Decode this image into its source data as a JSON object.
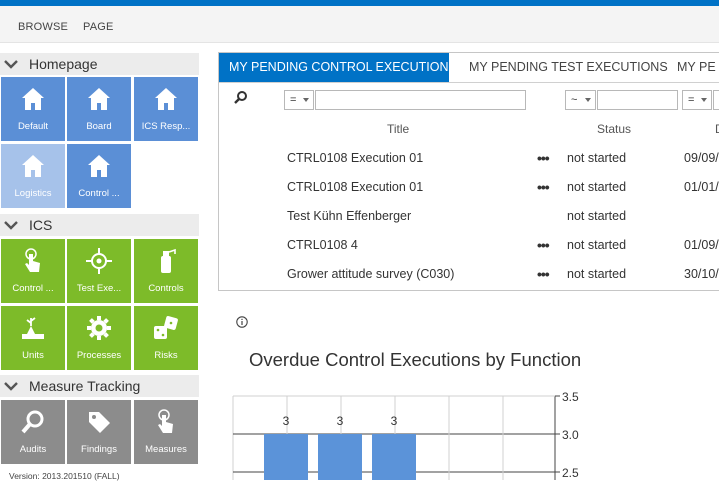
{
  "ribbon": {
    "tabs": [
      "BROWSE",
      "PAGE"
    ]
  },
  "nav": {
    "sections": [
      {
        "label": "Homepage",
        "tiles": [
          {
            "label": "Default",
            "icon": "home-icon"
          },
          {
            "label": "Board",
            "icon": "home-icon"
          },
          {
            "label": "ICS Resp...",
            "icon": "home-icon"
          },
          {
            "label": "Logistics",
            "icon": "home-icon"
          },
          {
            "label": "Control ...",
            "icon": "home-icon"
          }
        ]
      },
      {
        "label": "ICS",
        "tiles": [
          {
            "label": "Control ...",
            "icon": "touch-hand-icon"
          },
          {
            "label": "Test Exe...",
            "icon": "target-icon"
          },
          {
            "label": "Controls",
            "icon": "fire-extinguisher-icon"
          },
          {
            "label": "Units",
            "icon": "growth-plant-icon"
          },
          {
            "label": "Processes",
            "icon": "gear-icon"
          },
          {
            "label": "Risks",
            "icon": "dice-icon"
          }
        ]
      },
      {
        "label": "Measure Tracking",
        "tiles": [
          {
            "label": "Audits",
            "icon": "magnifier-icon"
          },
          {
            "label": "Findings",
            "icon": "tag-icon"
          },
          {
            "label": "Measures",
            "icon": "touch-hand-icon"
          }
        ]
      }
    ],
    "version": "Version: 2013.201510 (FALL)"
  },
  "panel": {
    "tabs": [
      "MY PENDING CONTROL EXECUTIONS",
      "MY PENDING TEST EXECUTIONS",
      "MY PE"
    ],
    "filters": {
      "title_op": "=",
      "status_op": "~",
      "date_op": "="
    },
    "columns": [
      "Title",
      "Status",
      "D"
    ],
    "rows": [
      {
        "title": "CTRL0108 Execution 01",
        "status": "not started",
        "date": "09/09/"
      },
      {
        "title": "CTRL0108 Execution 01",
        "status": "not started",
        "date": "01/01/"
      },
      {
        "title": "Test Kühn Effenberger",
        "status": "not started",
        "date": ""
      },
      {
        "title": "CTRL0108 4",
        "status": "not started",
        "date": "01/09/"
      },
      {
        "title": "Grower attitude survey (C030)",
        "status": "not started",
        "date": "30/10/"
      }
    ],
    "row_menu": "•••"
  },
  "chart_data": {
    "type": "bar",
    "title": "Overdue Control Executions by Function",
    "categories": [
      "",
      "",
      ""
    ],
    "values": [
      3,
      3,
      3
    ],
    "ylim": [
      2.5,
      3.5
    ],
    "yticks": [
      "3.5",
      "3.0",
      "2.5"
    ],
    "bar_color": "#5b93d9",
    "grid": true
  },
  "colors": {
    "accent": "#0072c6",
    "tile_blue": "#5b8fd6",
    "tile_green": "#7dbb29",
    "tile_grey": "#8c8c8c"
  }
}
